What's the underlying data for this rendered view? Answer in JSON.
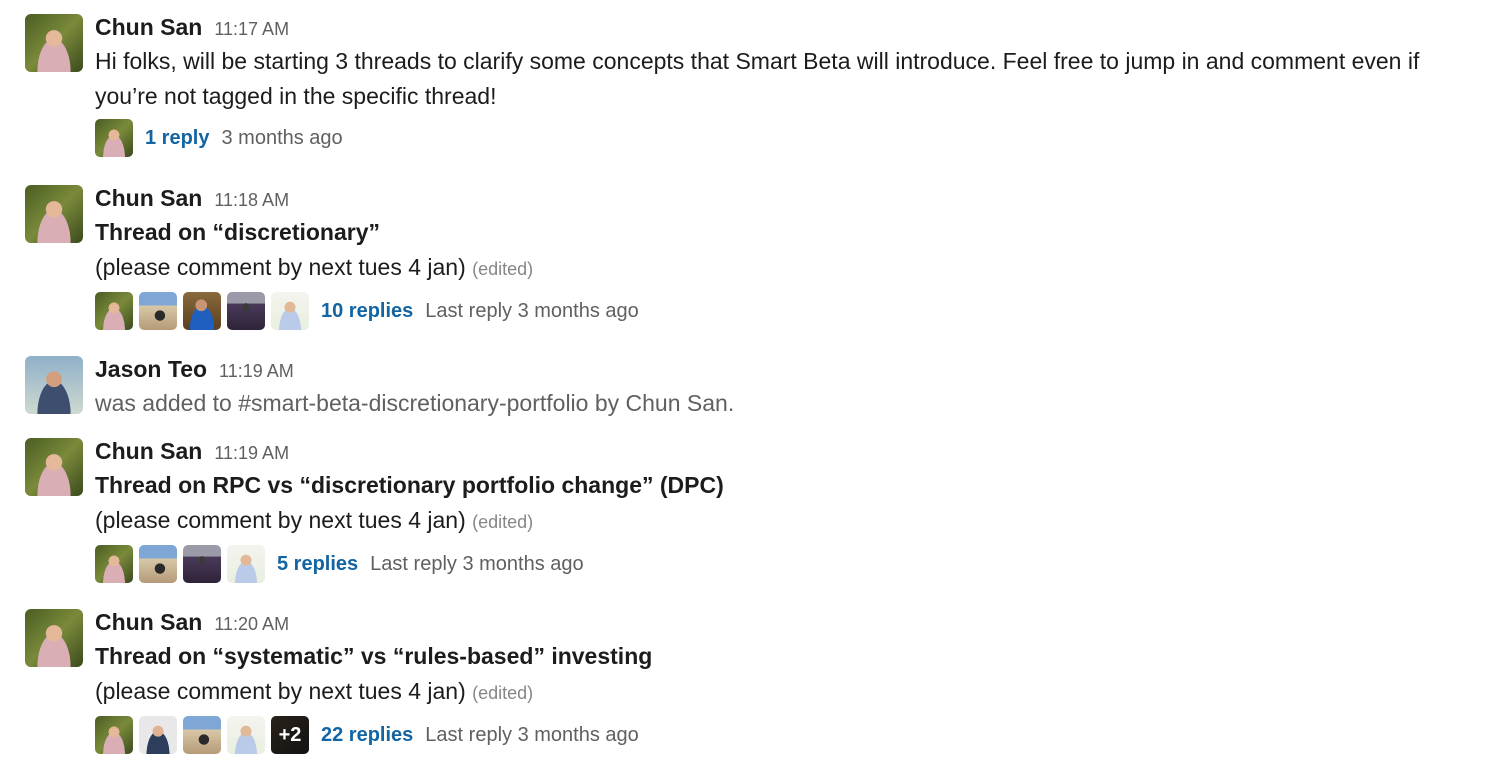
{
  "messages": [
    {
      "author": "Chun San",
      "time": "11:17 AM",
      "lines": [
        "Hi folks, will be starting 3 threads to clarify some concepts that Smart Beta will introduce. Feel free to jump in and comment even if you’re not tagged in the specific thread!"
      ],
      "thread": {
        "replies": "1 reply",
        "last": "3 months ago",
        "participants": [
          "chun-san"
        ]
      }
    },
    {
      "author": "Chun San",
      "time": "11:18 AM",
      "title": "Thread on “discretionary”",
      "subtitle": "(please comment by next tues 4 jan)",
      "edited": "(edited)",
      "thread": {
        "replies": "10 replies",
        "last": "Last reply 3 months ago",
        "participants": [
          "chun-san",
          "user-b",
          "user-c",
          "user-d",
          "user-e"
        ]
      }
    },
    {
      "author": "Jason Teo",
      "time": "11:19 AM",
      "system_text": "was added to #smart-beta-discretionary-portfolio by Chun San."
    },
    {
      "author": "Chun San",
      "time": "11:19 AM",
      "title": "Thread on RPC vs “discretionary portfolio change” (DPC)",
      "subtitle": "(please comment by next tues 4 jan)",
      "edited": "(edited)",
      "thread": {
        "replies": "5 replies",
        "last": "Last reply 3 months ago",
        "participants": [
          "chun-san",
          "user-b",
          "user-d",
          "user-e"
        ]
      }
    },
    {
      "author": "Chun San",
      "time": "11:20 AM",
      "title": "Thread on “systematic” vs “rules-based” investing",
      "subtitle": "(please comment by next tues 4 jan)",
      "edited": "(edited)",
      "thread": {
        "replies": "22 replies",
        "last": "Last reply 3 months ago",
        "participants": [
          "chun-san",
          "user-f",
          "user-b",
          "user-e"
        ],
        "more": "+2"
      }
    }
  ]
}
